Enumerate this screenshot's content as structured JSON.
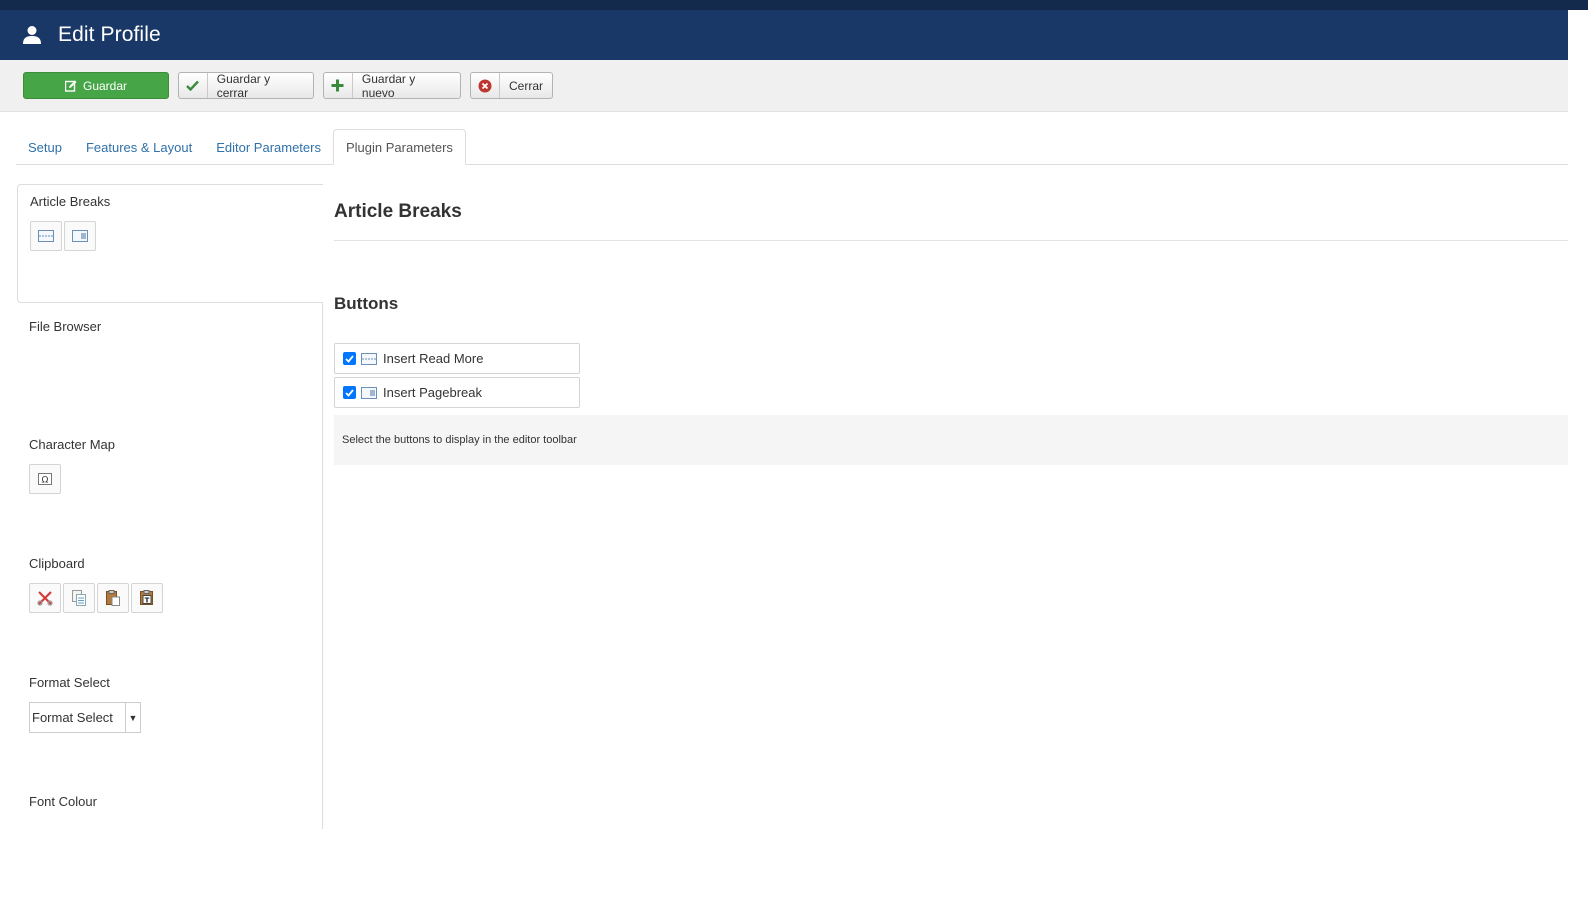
{
  "header": {
    "title": "Edit Profile"
  },
  "toolbar": {
    "save": "Guardar",
    "save_close": "Guardar y cerrar",
    "save_new": "Guardar y nuevo",
    "close": "Cerrar"
  },
  "tabs": [
    {
      "label": "Setup"
    },
    {
      "label": "Features & Layout"
    },
    {
      "label": "Editor Parameters"
    },
    {
      "label": "Plugin Parameters",
      "active": true
    }
  ],
  "sidebar": {
    "items": [
      {
        "title": "Article Breaks",
        "icons": [
          "insert-read-more-icon",
          "insert-pagebreak-icon"
        ]
      },
      {
        "title": "File Browser",
        "icons": []
      },
      {
        "title": "Character Map",
        "icons": [
          "omega-icon"
        ]
      },
      {
        "title": "Clipboard",
        "icons": [
          "cut-icon",
          "copy-icon",
          "paste-icon",
          "paste-text-icon"
        ]
      },
      {
        "title": "Format Select",
        "select_value": "Format Select"
      },
      {
        "title": "Font Colour"
      }
    ]
  },
  "content": {
    "heading": "Article Breaks",
    "subheading": "Buttons",
    "buttons": [
      {
        "label": "Insert Read More",
        "checked": true
      },
      {
        "label": "Insert Pagebreak",
        "checked": true
      }
    ],
    "help": "Select the buttons to display in the editor toolbar"
  },
  "colors": {
    "header_bg": "#1a3867",
    "save_green": "#46a546",
    "tab_link": "#3071a9",
    "checkbox": "#0075ff"
  }
}
